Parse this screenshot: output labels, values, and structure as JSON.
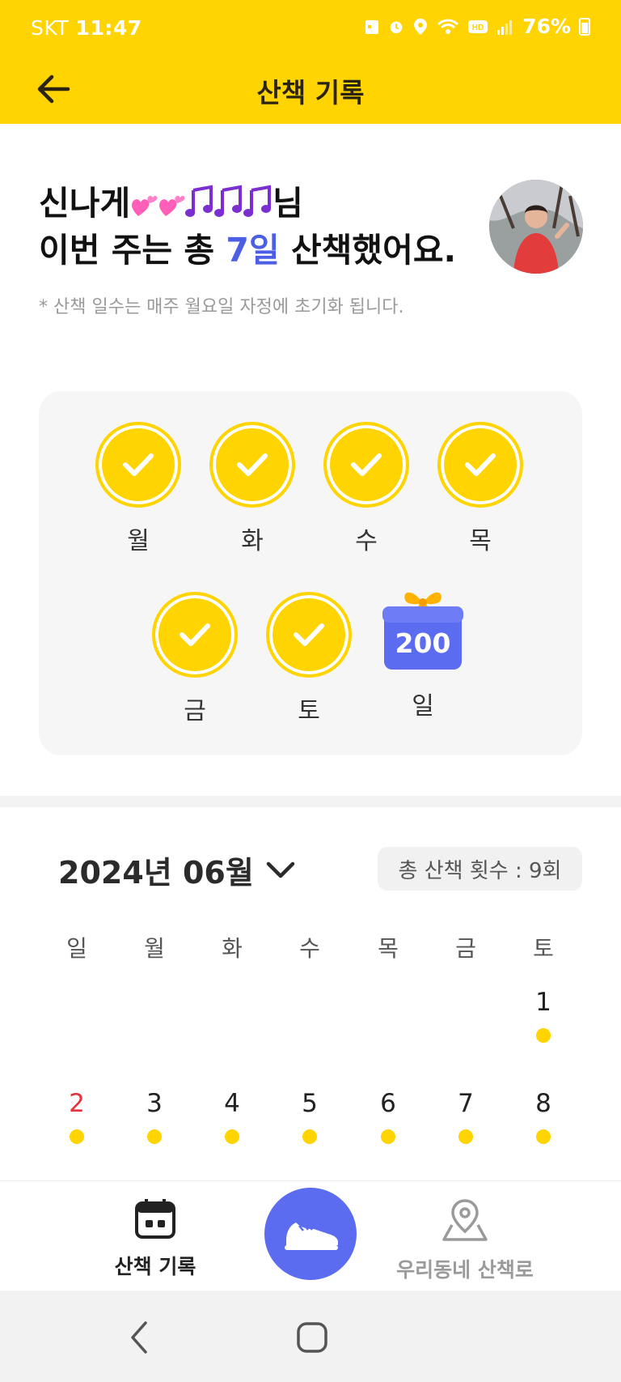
{
  "status_bar": {
    "carrier": "SKT",
    "time": "11:47",
    "battery": "76%"
  },
  "header": {
    "title": "산책 기록"
  },
  "greeting": {
    "name_prefix": "신나게",
    "name_suffix": "님",
    "line2_prefix": "이번 주는 총 ",
    "days_count": "7일",
    "line2_suffix": " 산책했어요.",
    "note": "* 산책 일수는 매주 월요일 자정에 초기화 됩니다."
  },
  "week": {
    "days": [
      {
        "label": "월",
        "done": true
      },
      {
        "label": "화",
        "done": true
      },
      {
        "label": "수",
        "done": true
      },
      {
        "label": "목",
        "done": true
      },
      {
        "label": "금",
        "done": true
      },
      {
        "label": "토",
        "done": true
      },
      {
        "label": "일",
        "done": false,
        "reward": "200"
      }
    ]
  },
  "calendar": {
    "month_label": "2024년 06월",
    "total_label": "총 산책 횟수 : 9회",
    "weekdays": [
      "일",
      "월",
      "화",
      "수",
      "목",
      "금",
      "토"
    ],
    "rows": [
      [
        null,
        null,
        null,
        null,
        null,
        null,
        {
          "day": "1",
          "walked": true
        }
      ],
      [
        {
          "day": "2",
          "walked": true,
          "sunday": true
        },
        {
          "day": "3",
          "walked": true
        },
        {
          "day": "4",
          "walked": true
        },
        {
          "day": "5",
          "walked": true
        },
        {
          "day": "6",
          "walked": true
        },
        {
          "day": "7",
          "walked": true
        },
        {
          "day": "8",
          "walked": true
        }
      ]
    ]
  },
  "bottom_nav": {
    "walk_record": "산책 기록",
    "neighborhood": "우리동네 산책로"
  },
  "colors": {
    "brand_yellow": "#FFD400",
    "accent_blue": "#5b6cf0",
    "count_blue": "#4b5ee4",
    "sunday_red": "#e5333b"
  }
}
